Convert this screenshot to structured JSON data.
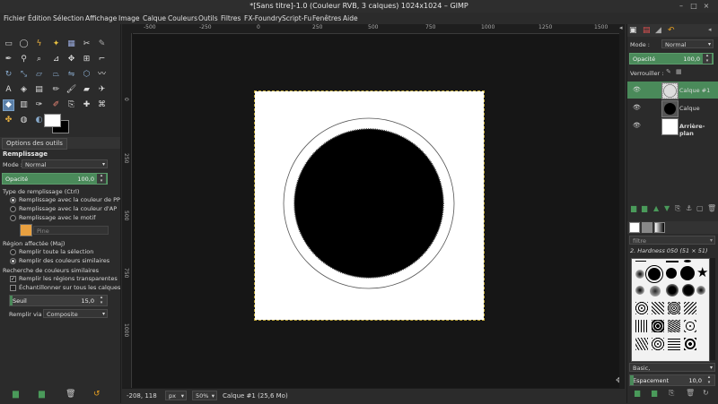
{
  "window": {
    "title": "*[Sans titre]-1.0 (Couleur RVB, 3 calques) 1024x1024 – GIMP",
    "controls": [
      "–",
      "□",
      "×"
    ]
  },
  "menubar": {
    "items": [
      "Fichier",
      "Édition",
      "Sélection",
      "Affichage",
      "Image",
      "Calque",
      "Couleurs",
      "Outils",
      "Filtres",
      "FX-Foundry",
      "Script-Fu",
      "Fenêtres",
      "Aide"
    ]
  },
  "tool_options": {
    "tab_label": "Options des outils",
    "tool_name": "Remplissage",
    "mode_label": "Mode :",
    "mode_value": "Normal",
    "opacity_label": "Opacité",
    "opacity_value": "100,0",
    "fill_type_heading": "Type de remplissage (Ctrl)",
    "fill_options": [
      "Remplissage avec la couleur de PP",
      "Remplissage avec la couleur d'AP",
      "Remplissage avec le motif"
    ],
    "pattern_name": "Pine",
    "region_heading": "Région affectée (Maj)",
    "region_options": [
      "Remplir toute la sélection",
      "Remplir des couleurs similaires"
    ],
    "similar_heading": "Recherche de couleurs similaires",
    "checkboxes": [
      "Remplir les régions transparentes",
      "Échantillonner sur tous les calques"
    ],
    "threshold_label": "Seuil",
    "threshold_value": "15,0",
    "fill_by_label": "Remplir via",
    "fill_by_value": "Composite"
  },
  "rulers": {
    "horizontal": [
      "-500",
      "-250",
      "0",
      "250",
      "500",
      "750",
      "1000",
      "1250",
      "1500"
    ],
    "vertical": [
      "0",
      "250",
      "500",
      "750",
      "1000"
    ]
  },
  "statusbar": {
    "coords": "-208, 118",
    "unit": "px",
    "zoom": "50%",
    "layer_info": "Calque #1 (25,6 Mo)"
  },
  "layers_panel": {
    "mode_label": "Mode :",
    "mode_value": "Normal",
    "opacity_label": "Opacité",
    "opacity_value": "100,0",
    "lock_label": "Verrouiller :",
    "layers": [
      {
        "name": "Calque #1",
        "selected": true
      },
      {
        "name": "Calque",
        "selected": false
      },
      {
        "name": "Arrière-plan",
        "selected": false
      }
    ]
  },
  "brushes_panel": {
    "filter_placeholder": "filtre",
    "brush_name": "2. Hardness 050 (51 × 51)",
    "preset_value": "Basic,",
    "spacing_label": "Espacement",
    "spacing_value": "10,0"
  },
  "colors": {
    "accent_green": "#4a8a5a",
    "tool_active": "#5a7fa8",
    "canvas_bg": "#161616"
  }
}
